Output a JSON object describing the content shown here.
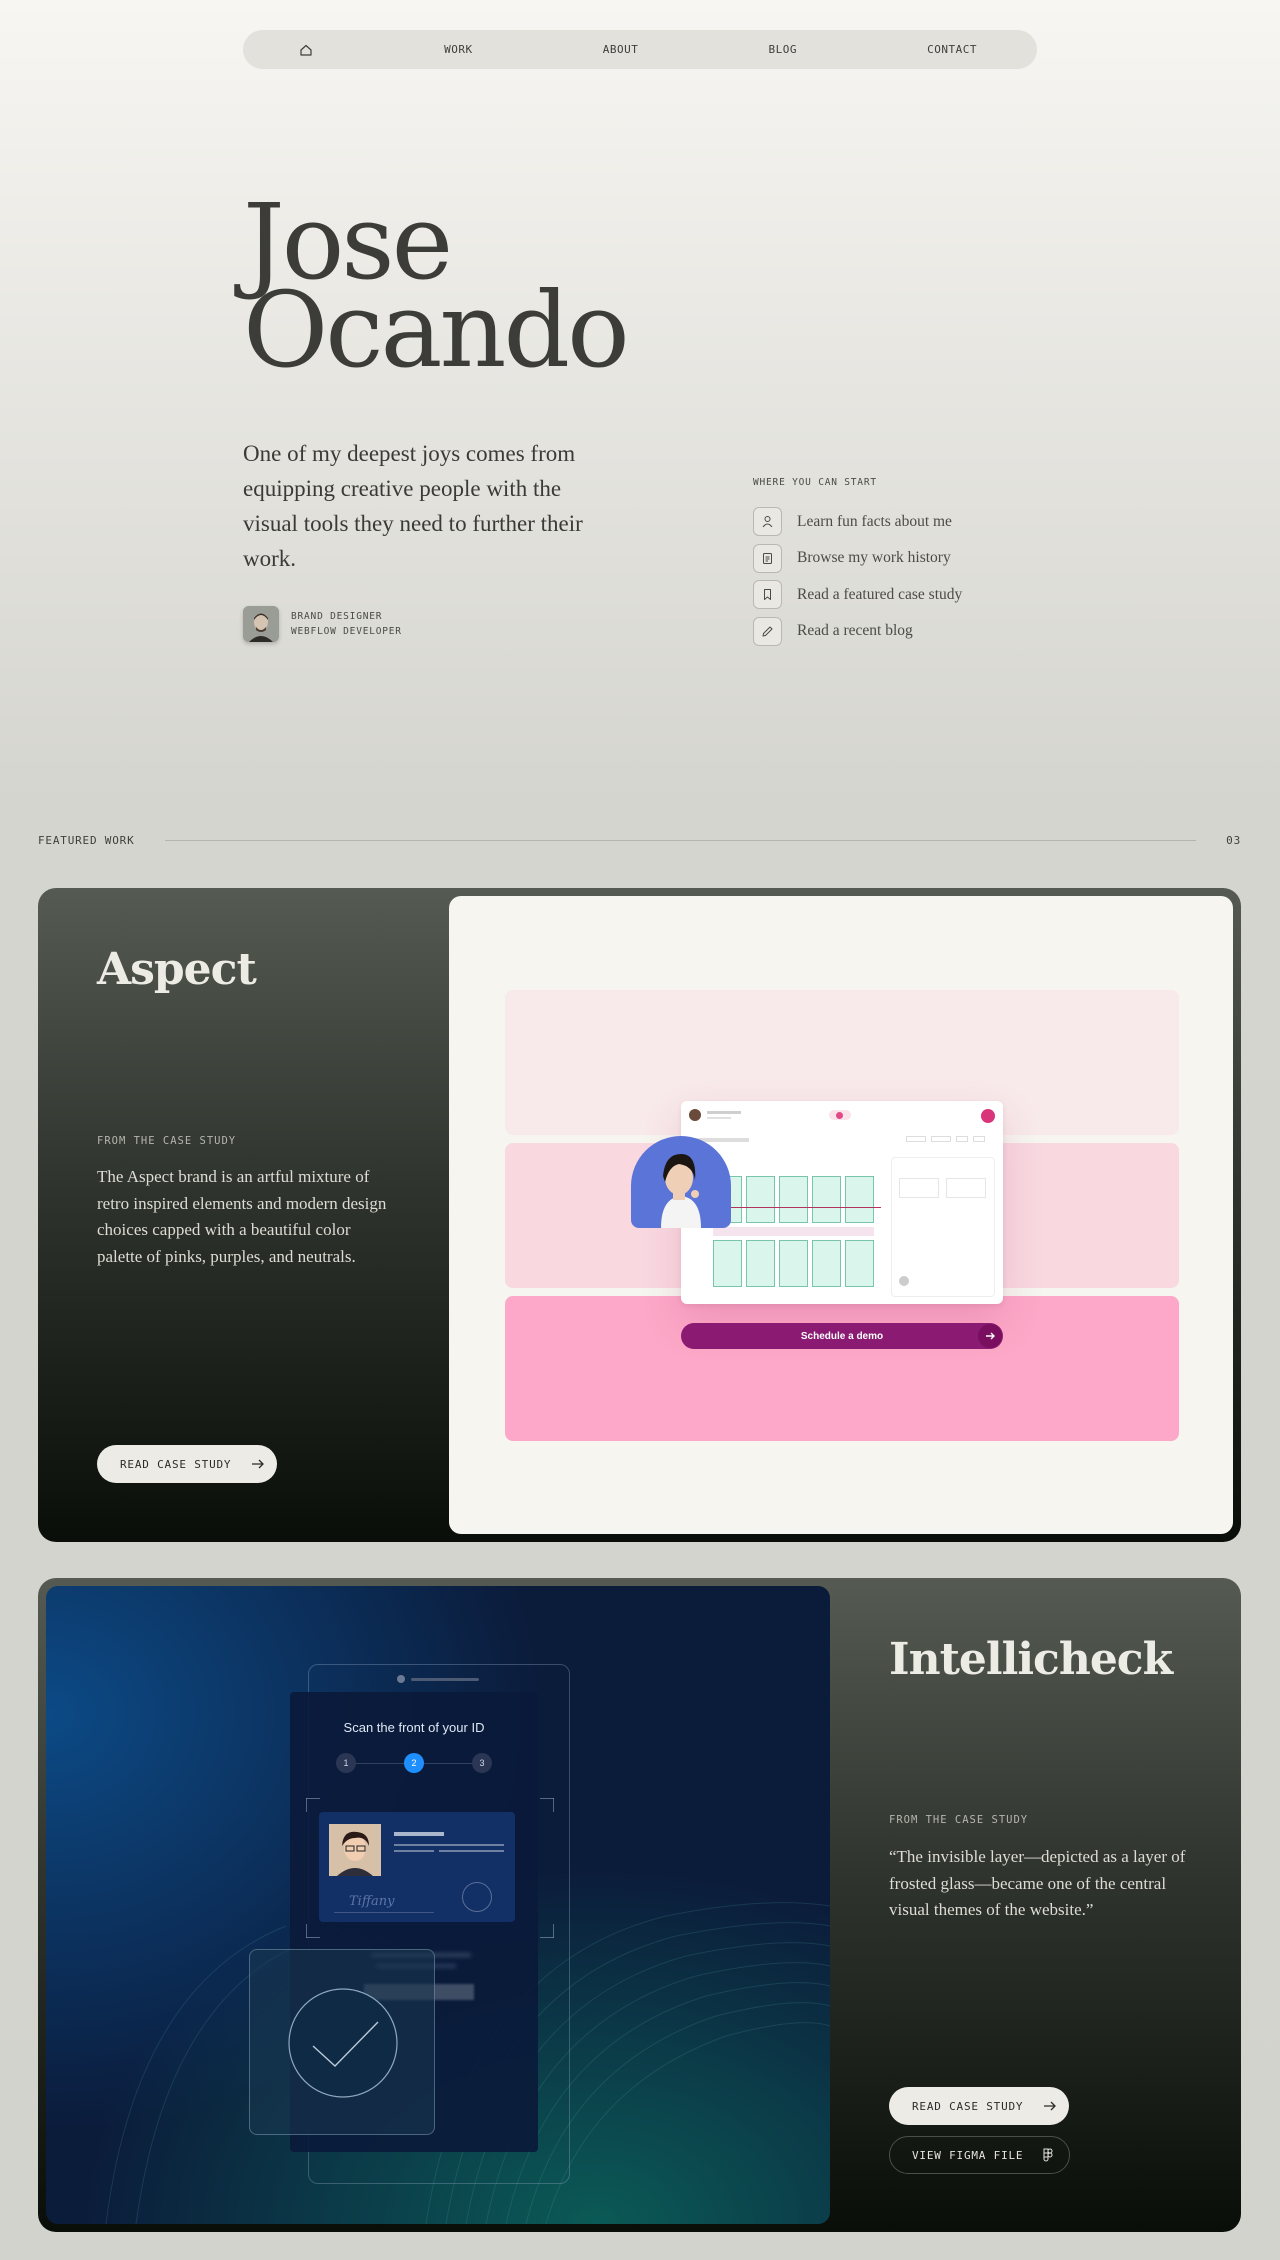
{
  "nav": {
    "home_icon": "home-icon",
    "items": [
      "WORK",
      "ABOUT",
      "BLOG",
      "CONTACT"
    ]
  },
  "hero": {
    "first_name": "Jose",
    "last_name": "Ocando",
    "intro": "One of my deepest joys comes from equipping creative people with the visual tools they need to further their work.",
    "roles": [
      "BRAND DESIGNER",
      "WEBFLOW DEVELOPER"
    ]
  },
  "start": {
    "title": "WHERE YOU CAN START",
    "items": [
      {
        "label": "Learn fun facts about me",
        "icon": "person-icon"
      },
      {
        "label": "Browse my work history",
        "icon": "document-icon"
      },
      {
        "label": "Read a featured case study",
        "icon": "bookmark-icon"
      },
      {
        "label": "Read a recent blog",
        "icon": "pencil-icon"
      }
    ]
  },
  "featured": {
    "label": "FEATURED WORK",
    "count": "03"
  },
  "projects": [
    {
      "title": "Aspect",
      "eyebrow": "FROM THE CASE STUDY",
      "description": "The Aspect brand is an artful mixture of retro inspired elements and modern design choices capped with a beautiful color palette of pinks, purples, and neutrals.",
      "primary_button": "READ CASE STUDY",
      "image": {
        "cta": "Schedule a demo",
        "band_colors": [
          "#f8e9ea",
          "#f9d8e0",
          "#fda8c8"
        ]
      }
    },
    {
      "title": "Intellicheck",
      "eyebrow": "FROM THE CASE STUDY",
      "description": "“The invisible layer—depicted as a layer of frosted glass—became one of the central visual themes of the website.”",
      "primary_button": "READ CASE STUDY",
      "secondary_button": "VIEW FIGMA FILE",
      "image": {
        "heading": "Scan the front of your ID",
        "steps": [
          "1",
          "2",
          "3"
        ],
        "signature": "Tiffany"
      }
    }
  ]
}
